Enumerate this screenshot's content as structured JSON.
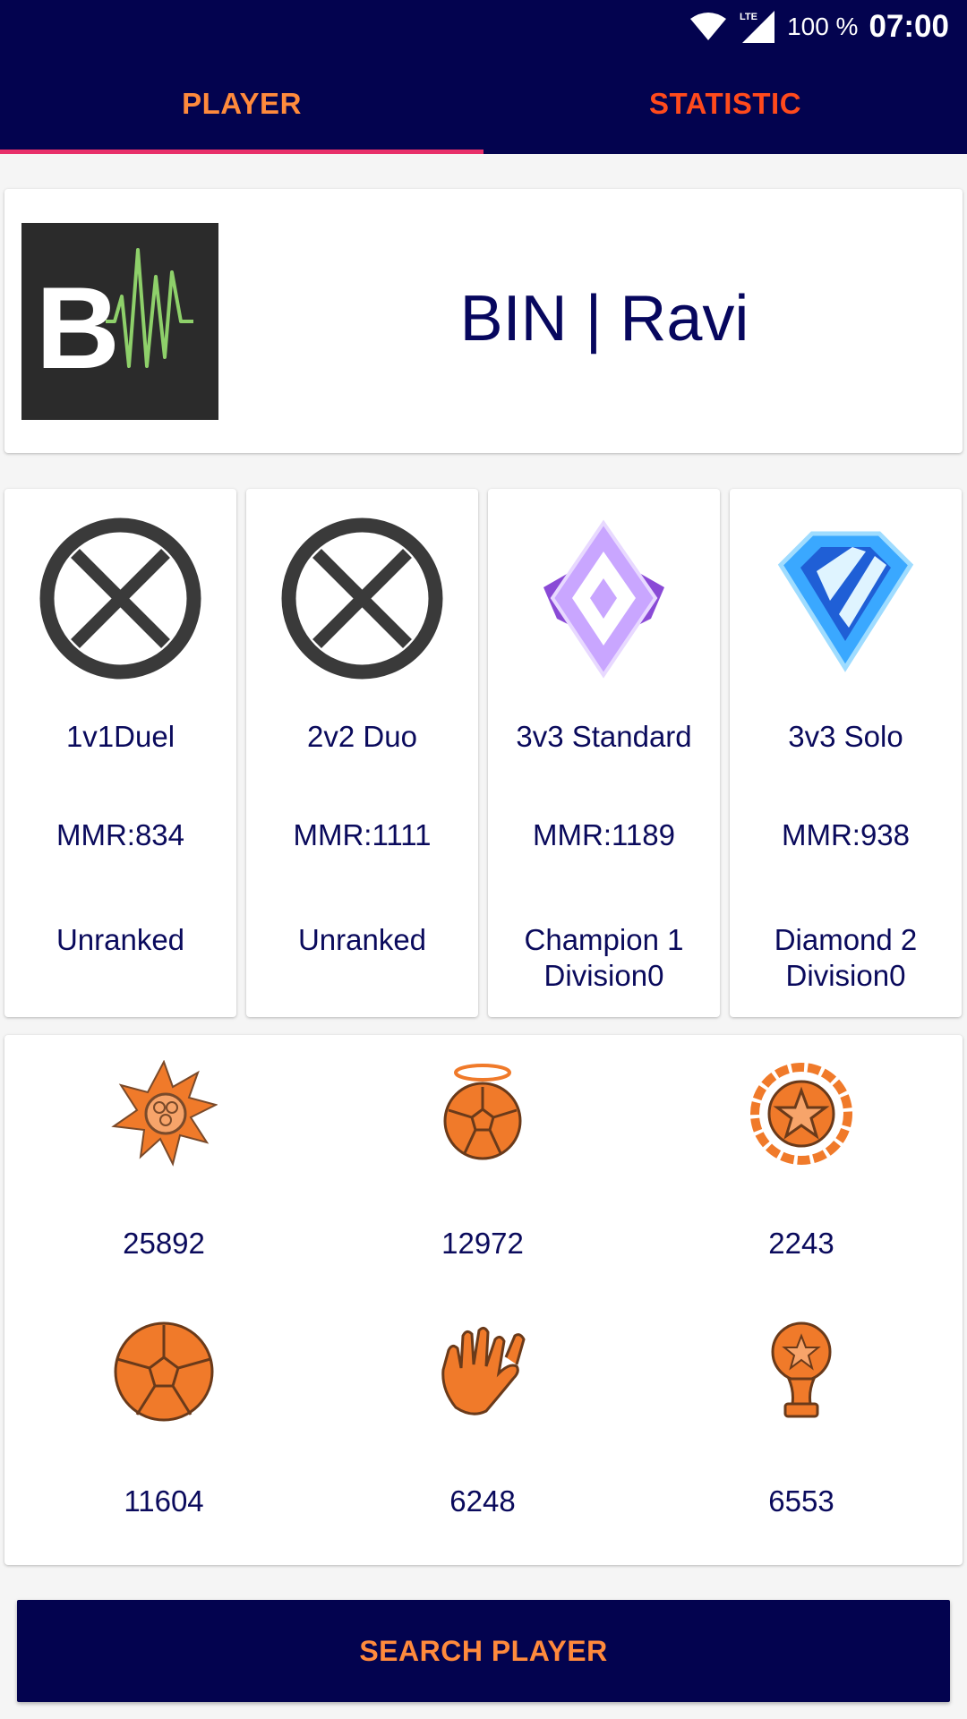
{
  "status_bar": {
    "network": "LTE",
    "battery": "100 %",
    "time": "07:00"
  },
  "tabs": [
    {
      "label": "PLAYER",
      "selected": true
    },
    {
      "label": "STATISTIC",
      "selected": false
    }
  ],
  "player": {
    "name": "BIN | Ravi",
    "avatar_letter": "B",
    "avatar_icon": "waveform-logo"
  },
  "ranks": [
    {
      "playlist": "1v1Duel",
      "mmr": "MMR:834",
      "tier": "Unranked",
      "division": "",
      "icon": "unranked-x-icon"
    },
    {
      "playlist": "2v2 Duo",
      "mmr": "MMR:1111",
      "tier": "Unranked",
      "division": "",
      "icon": "unranked-x-icon"
    },
    {
      "playlist": "3v3 Standard",
      "mmr": "MMR:1189",
      "tier": "Champion 1",
      "division": "Division0",
      "icon": "champion-rank-icon"
    },
    {
      "playlist": "3v3 Solo",
      "mmr": "MMR:938",
      "tier": "Diamond 2",
      "division": "Division0",
      "icon": "diamond-rank-icon"
    }
  ],
  "stats": [
    {
      "icon": "shots-icon",
      "value": "25892"
    },
    {
      "icon": "saves-icon",
      "value": "12972"
    },
    {
      "icon": "mvps-icon",
      "value": "2243"
    },
    {
      "icon": "goals-icon",
      "value": "11604"
    },
    {
      "icon": "assists-icon",
      "value": "6248"
    },
    {
      "icon": "wins-icon",
      "value": "6553"
    }
  ],
  "search_button": {
    "label": "SEARCH PLAYER"
  },
  "colors": {
    "header_bg": "#03034f",
    "tab_active": "#ff8a3c",
    "tab_inactive": "#ff4a1c",
    "indicator": "#e8306a",
    "text": "#0a0a5c",
    "stat_orange": "#f07a2a"
  }
}
